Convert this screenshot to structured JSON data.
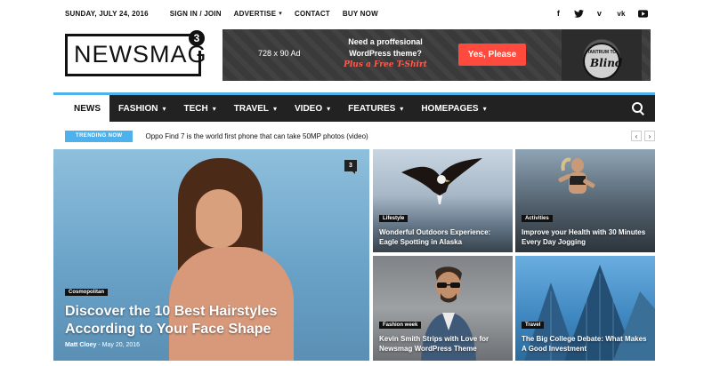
{
  "topbar": {
    "date": "SUNDAY, JULY 24, 2016",
    "links": [
      {
        "label": "SIGN IN / JOIN",
        "dropdown": false
      },
      {
        "label": "ADVERTISE",
        "dropdown": true
      },
      {
        "label": "CONTACT",
        "dropdown": false
      },
      {
        "label": "BUY NOW",
        "dropdown": false
      }
    ],
    "socials": [
      "facebook-icon",
      "twitter-icon",
      "vimeo-icon",
      "vk-icon",
      "youtube-icon"
    ]
  },
  "logo": {
    "text": "NEWSMAG",
    "badge": "3"
  },
  "ad": {
    "size_text": "728 x 90 Ad",
    "pitch_line1": "Need a proffesional",
    "pitch_line2": "WordPress theme?",
    "pitch_line3": "Plus a Free T-Shirt",
    "cta": "Yes, Please",
    "shirt_top": "TANTRUM TO",
    "shirt_script": "Blind"
  },
  "nav": {
    "items": [
      {
        "label": "NEWS",
        "active": true,
        "dropdown": false
      },
      {
        "label": "FASHION",
        "active": false,
        "dropdown": true
      },
      {
        "label": "TECH",
        "active": false,
        "dropdown": true
      },
      {
        "label": "TRAVEL",
        "active": false,
        "dropdown": true
      },
      {
        "label": "VIDEO",
        "active": false,
        "dropdown": true
      },
      {
        "label": "FEATURES",
        "active": false,
        "dropdown": true
      },
      {
        "label": "HOMEPAGES",
        "active": false,
        "dropdown": true
      }
    ]
  },
  "trending": {
    "label": "TRENDING NOW",
    "headline": "Oppo Find 7 is the world first phone that can take 50MP photos (video)",
    "prev": "‹",
    "next": "›"
  },
  "featured": {
    "main": {
      "category": "Cosmopolitan",
      "title": "Discover the 10 Best Hairstyles According to Your Face Shape",
      "author": "Matt Cloey",
      "separator": "-",
      "date": "May 20, 2016",
      "comments": "3"
    },
    "tiles": [
      {
        "category": "Lifestyle",
        "title": "Wonderful Outdoors Experience: Eagle Spotting in Alaska"
      },
      {
        "category": "Activities",
        "title": "Improve your Health with 30 Minutes Every Day Jogging"
      },
      {
        "category": "Fashion week",
        "title": "Kevin Smith Strips with Love for Newsmag WordPress Theme"
      },
      {
        "category": "Travel",
        "title": "The Big College Debate: What Makes A Good Investment"
      }
    ]
  },
  "colors": {
    "accent": "#4db2ec",
    "nav_bg": "#222222",
    "cta": "#ff4a3d"
  }
}
